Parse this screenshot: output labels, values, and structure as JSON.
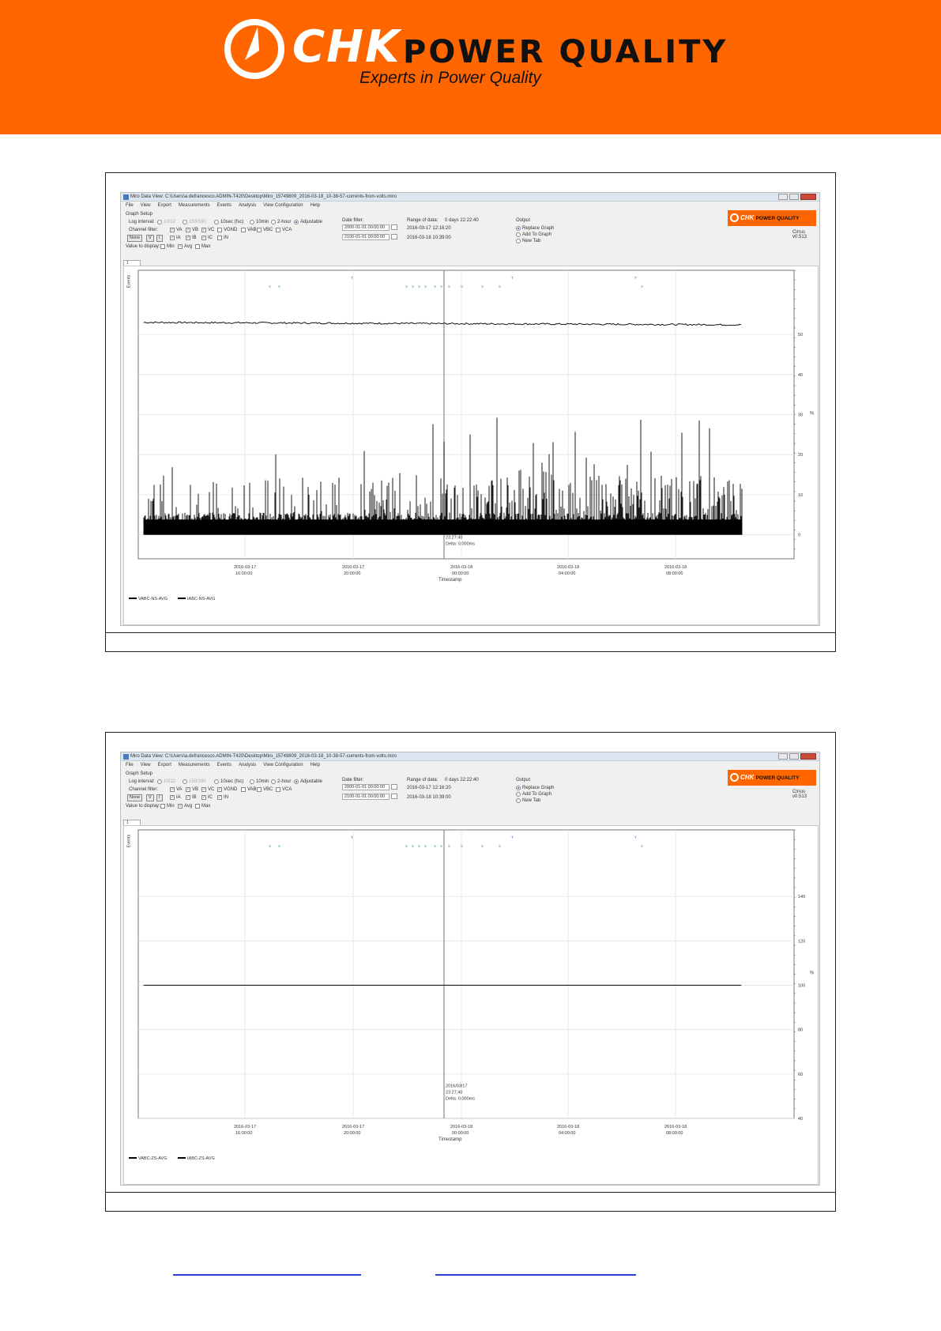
{
  "header": {
    "brand": "CHK",
    "brand_tail": "POWER QUALITY",
    "tagline": "Experts in Power Quality"
  },
  "screenshots": [
    {
      "window_title": "Miro Data View: C:\\Users\\a.defrancesco.ADMIN-T420\\Desktop\\Miro_15749809_2016-03-18_10-38-57-currents-from-volts.miro",
      "menu": [
        "File",
        "View",
        "Export",
        "Measurements",
        "Events",
        "Analysis",
        "View Configuration",
        "Help"
      ],
      "graph_setup_label": "Graph Setup",
      "log_interval_label": "Log interval:",
      "log_intervals": [
        {
          "label": "10/12",
          "state": "disabled"
        },
        {
          "label": "150/180",
          "state": "disabled"
        },
        {
          "label": "10sec (fsc)",
          "state": "off"
        },
        {
          "label": "10min",
          "state": "off"
        },
        {
          "label": "2-hour",
          "state": "off"
        },
        {
          "label": "Adjustable",
          "state": "on"
        }
      ],
      "channel_filter_label": "Channel filter:",
      "buttons": [
        "None",
        "V",
        "I"
      ],
      "channels_row1": [
        {
          "label": "VA",
          "checked": true
        },
        {
          "label": "VB",
          "checked": true
        },
        {
          "label": "VC",
          "checked": true
        },
        {
          "label": "VGND",
          "checked": false
        },
        {
          "label": "VAB",
          "checked": false
        },
        {
          "label": "VBC",
          "checked": false
        },
        {
          "label": "VCA",
          "checked": false
        }
      ],
      "channels_row2": [
        {
          "label": "IA",
          "checked": true
        },
        {
          "label": "IB",
          "checked": true
        },
        {
          "label": "IC",
          "checked": true
        },
        {
          "label": "IN",
          "checked": false
        }
      ],
      "value_display_label": "Value to display:",
      "value_display": [
        {
          "label": "Min",
          "checked": false
        },
        {
          "label": "Avg",
          "checked": true
        },
        {
          "label": "Max",
          "checked": false
        }
      ],
      "date_filter_label": "Date filter:",
      "date_from": "2000-01-01 00:00:00",
      "date_to": "2100-01-01 00:00:00",
      "range_label": "Range of data:",
      "range_duration": "0 days 22:22:40",
      "range_start": "2016-03-17 12:16:20",
      "range_end": "2016-03-18 10:39:00",
      "output_label": "Output",
      "output_options": [
        {
          "label": "Replace Graph",
          "state": "on"
        },
        {
          "label": "Add To Graph",
          "state": "off"
        },
        {
          "label": "New Tab",
          "state": "off"
        }
      ],
      "mini_logo": "CHK",
      "mini_logo_tail": "POWER QUALITY",
      "version": "Cirrus v0.513",
      "tab_label": "1",
      "events_axis_label": "Events",
      "cursor_lines": [
        "23:27:40",
        "Delta: 0.000ms"
      ],
      "chart_data": {
        "type": "line",
        "xlabel": "Timestamp",
        "ylabel": "%",
        "x_ticks": [
          "2016-03-17\n16:00:00",
          "2016-03-17\n20:00:00",
          "2016-03-18\n00:00:00",
          "2016-03-18\n04:00:00",
          "2016-03-18\n08:00:00"
        ],
        "y_ticks": [
          "0",
          "10",
          "20",
          "30",
          "40",
          "50"
        ],
        "ylim": [
          -6,
          66
        ],
        "series": [
          {
            "name": "VABC-NS-AVG",
            "color": "#111111",
            "level": 53,
            "noise": 0.4
          },
          {
            "name": "IABC-NS-AVG",
            "color": "#000000",
            "level": 3,
            "spiky": true,
            "max_spike": 28
          }
        ],
        "cursor_time": "2016-03-17 23:27:40",
        "legend": "bottom-left"
      }
    },
    {
      "window_title": "Miro Data View: C:\\Users\\a.defrancesco.ADMIN-T420\\Desktop\\Miro_15749809_2016-03-18_10-38-57-currents-from-volts.miro",
      "menu": [
        "File",
        "View",
        "Export",
        "Measurements",
        "Events",
        "Analysis",
        "View Configuration",
        "Help"
      ],
      "graph_setup_label": "Graph Setup",
      "log_interval_label": "Log interval:",
      "log_intervals": [
        {
          "label": "10/12",
          "state": "disabled"
        },
        {
          "label": "150/180",
          "state": "disabled"
        },
        {
          "label": "10sec (fsc)",
          "state": "off"
        },
        {
          "label": "10min",
          "state": "off"
        },
        {
          "label": "2-hour",
          "state": "off"
        },
        {
          "label": "Adjustable",
          "state": "on"
        }
      ],
      "channel_filter_label": "Channel filter:",
      "buttons": [
        "None",
        "V",
        "I"
      ],
      "channels_row1": [
        {
          "label": "VA",
          "checked": true
        },
        {
          "label": "VB",
          "checked": true
        },
        {
          "label": "VC",
          "checked": true
        },
        {
          "label": "VGND",
          "checked": true
        },
        {
          "label": "VAB",
          "checked": false
        },
        {
          "label": "VBC",
          "checked": false
        },
        {
          "label": "VCA",
          "checked": false
        }
      ],
      "channels_row2": [
        {
          "label": "IA",
          "checked": true
        },
        {
          "label": "IB",
          "checked": true
        },
        {
          "label": "IC",
          "checked": true
        },
        {
          "label": "IN",
          "checked": true
        }
      ],
      "value_display_label": "Value to display:",
      "value_display": [
        {
          "label": "Min",
          "checked": false
        },
        {
          "label": "Avg",
          "checked": true
        },
        {
          "label": "Max",
          "checked": false
        }
      ],
      "date_filter_label": "Date filter:",
      "date_from": "2000-01-01 00:00:00",
      "date_to": "2100-01-01 00:00:00",
      "range_label": "Range of data:",
      "range_duration": "0 days 22:22:40",
      "range_start": "2016-03-17 12:16:20",
      "range_end": "2016-03-18 10:39:00",
      "output_label": "Output",
      "output_options": [
        {
          "label": "Replace Graph",
          "state": "on"
        },
        {
          "label": "Add To Graph",
          "state": "off"
        },
        {
          "label": "New Tab",
          "state": "off"
        }
      ],
      "mini_logo": "CHK",
      "mini_logo_tail": "POWER QUALITY",
      "version": "Cirrus v0.513",
      "tab_label": "1",
      "events_axis_label": "Events",
      "cursor_lines": [
        "2016/03/17",
        "23:27:40",
        "Delta: 0.000ms"
      ],
      "chart_data": {
        "type": "line",
        "xlabel": "Timestamp",
        "ylabel": "%",
        "x_ticks": [
          "2016-03-17\n16:00:00",
          "2016-03-17\n20:00:00",
          "2016-03-18\n00:00:00",
          "2016-03-18\n04:00:00",
          "2016-03-18\n08:00:00"
        ],
        "y_ticks": [
          "40",
          "60",
          "80",
          "100",
          "120",
          "140"
        ],
        "ylim": [
          40,
          170
        ],
        "series": [
          {
            "name": "VABC-ZS-AVG",
            "color": "#111111",
            "level": 100,
            "noise": 0
          },
          {
            "name": "IABC-ZS-AVG",
            "color": "#000000",
            "level": 100,
            "noise": 0
          }
        ],
        "cursor_time": "2016-03-17 23:27:40",
        "legend": "bottom-left"
      }
    }
  ],
  "events_markers": [
    "S",
    "S",
    "T",
    "S",
    "S",
    "S",
    "S",
    "S",
    "S",
    "S",
    "S",
    "S",
    "S",
    "T",
    "T",
    "S"
  ]
}
